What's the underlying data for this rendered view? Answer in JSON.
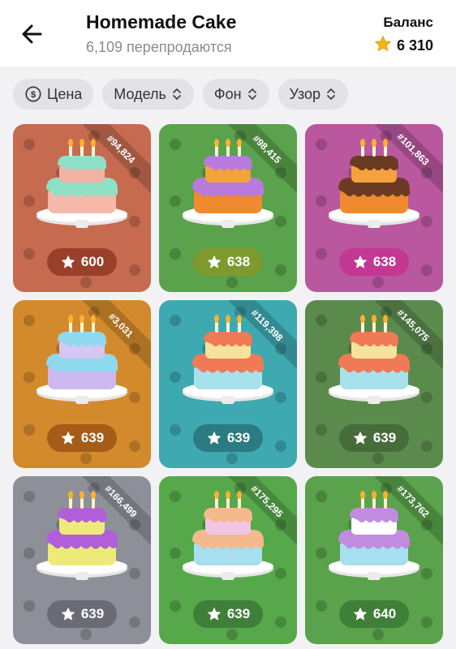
{
  "header": {
    "title": "Homemade Cake",
    "subtitle": "6,109 перепродаются",
    "balance_label": "Баланс",
    "balance_value": "6 310"
  },
  "filters": [
    {
      "label": "Цена",
      "icon": "price-icon"
    },
    {
      "label": "Модель",
      "icon": "sort-icon"
    },
    {
      "label": "Фон",
      "icon": "sort-icon"
    },
    {
      "label": "Узор",
      "icon": "sort-icon"
    }
  ],
  "items": [
    {
      "number": "#94,824",
      "price": "600",
      "bg": "#c66b50",
      "pill": "#9a3f2a",
      "frost1": "#8fe0c7",
      "cake1": "#f3b3a2",
      "frost2": "#8fe0c7",
      "cake2": "#f6b8a8"
    },
    {
      "number": "#98,415",
      "price": "638",
      "bg": "#5aa24b",
      "pill": "#7e9a2f",
      "frost1": "#b87adc",
      "cake1": "#f4a23a",
      "frost2": "#b87adc",
      "cake2": "#f08a30"
    },
    {
      "number": "#101,863",
      "price": "638",
      "bg": "#b9579f",
      "pill": "#c33892",
      "frost1": "#6b3a22",
      "cake1": "#f6a23c",
      "frost2": "#6b3a22",
      "cake2": "#f08a30"
    },
    {
      "number": "#3,031",
      "price": "639",
      "bg": "#d38a2d",
      "pill": "#a45c17",
      "frost1": "#8fd9ef",
      "cake1": "#d6c6f4",
      "frost2": "#8fd9ef",
      "cake2": "#cdb9f2"
    },
    {
      "number": "#119,398",
      "price": "639",
      "bg": "#3ea9b0",
      "pill": "#2b7b83",
      "frost1": "#f07a55",
      "cake1": "#f5e39a",
      "frost2": "#f07a55",
      "cake2": "#a7e2ec"
    },
    {
      "number": "#145,075",
      "price": "639",
      "bg": "#5b8a4d",
      "pill": "#466c3a",
      "frost1": "#f07a55",
      "cake1": "#f5e39a",
      "frost2": "#f07a55",
      "cake2": "#a7e2ec"
    },
    {
      "number": "#166,499",
      "price": "639",
      "bg": "#8e9099",
      "pill": "#6a6b75",
      "frost1": "#b15fd8",
      "cake1": "#eeea7a",
      "frost2": "#b15fd8",
      "cake2": "#eeea7a"
    },
    {
      "number": "#175,295",
      "price": "639",
      "bg": "#56a84b",
      "pill": "#3f7f39",
      "frost1": "#f4b98c",
      "cake1": "#f2c5e4",
      "frost2": "#f4b98c",
      "cake2": "#a7dff0"
    },
    {
      "number": "#173,762",
      "price": "640",
      "bg": "#5aa24b",
      "pill": "#3f7f39",
      "frost1": "#c18be0",
      "cake1": "#ffffff",
      "frost2": "#c18be0",
      "cake2": "#a7dff0"
    }
  ]
}
